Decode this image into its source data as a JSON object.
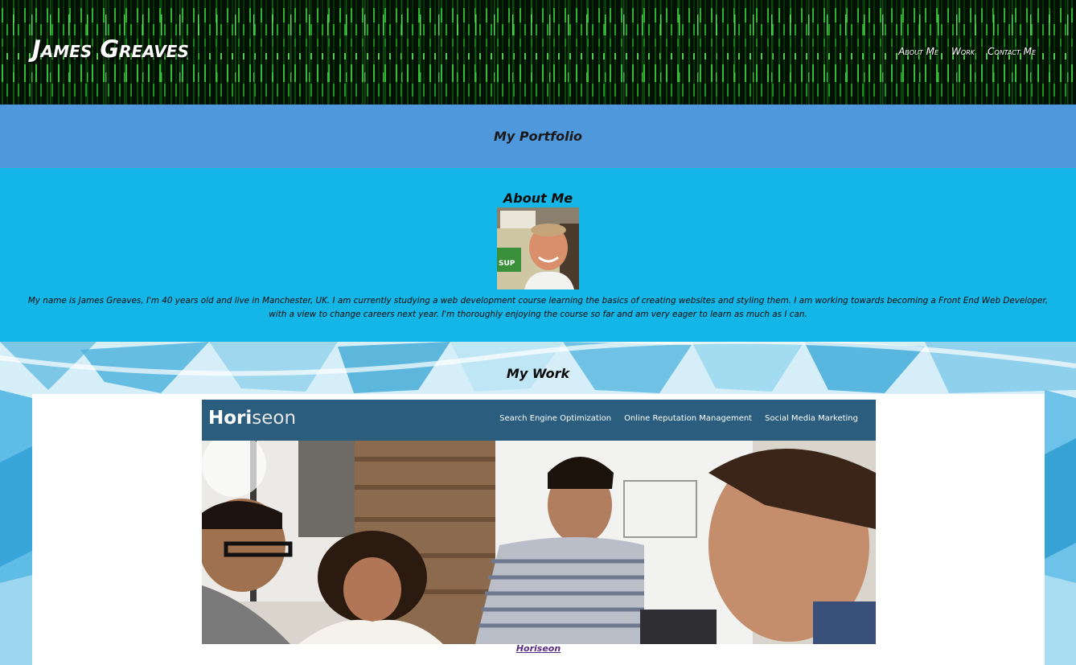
{
  "header": {
    "title": "James Greaves",
    "nav": [
      "About Me",
      "Work",
      "Contact Me"
    ]
  },
  "portfolio": {
    "heading": "My Portfolio"
  },
  "about": {
    "heading": "About Me",
    "text": "My name is James Greaves, I'm 40 years old and live in Manchester, UK. I am currently studying a web development course learning the basics of creating websites and styling them. I am working towards becoming a Front End Web Developer, with a view to change careers next year. I'm thoroughly enjoying the course so far and am very eager to learn as much as I can."
  },
  "work": {
    "heading": "My Work",
    "project": {
      "logo_bold": "Hori",
      "logo_thin": "seon",
      "nav": [
        "Search Engine Optimization",
        "Online Reputation Management",
        "Social Media Marketing"
      ],
      "link_text": "Horiseon"
    }
  },
  "colors": {
    "portfolio_band": "#4f98dc",
    "about_band": "#13b6e6",
    "project_header": "#2a5d7e",
    "link": "#5a2a82"
  }
}
